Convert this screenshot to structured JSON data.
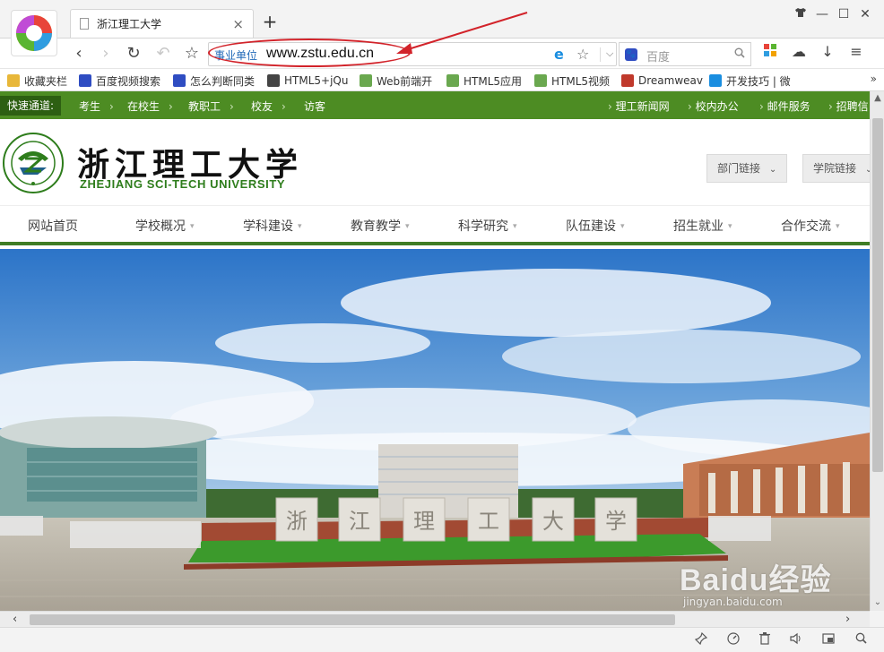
{
  "browser": {
    "tab": {
      "title": "浙江理工大学",
      "close": "×"
    },
    "new_tab": "+",
    "window_controls": {
      "minimize": "—",
      "maximize": "☐",
      "close": "✕",
      "skin": "👕"
    },
    "nav": {
      "back": "‹",
      "forward": "›",
      "reload": "↻",
      "undo": "↶",
      "favorite": "☆"
    },
    "address": {
      "badge": "事业单位",
      "url": "www.zstu.edu.cn"
    },
    "address_icons": {
      "ie": "e",
      "star": "☆",
      "dropdown": "⌵"
    },
    "search": {
      "placeholder": "百度",
      "engine_icon": "baidu-icon"
    },
    "tools": {
      "apps": "▦",
      "cloud": "☁",
      "download": "↓",
      "menu": "≡"
    },
    "bookmarks": [
      {
        "label": "收藏夹栏",
        "icon": "folder-icon",
        "color": "#e8b739"
      },
      {
        "label": "百度视频搜索",
        "icon": "baidu-icon",
        "color": "#2f4dc2"
      },
      {
        "label": "怎么判断同类",
        "icon": "baidu-icon",
        "color": "#2f4dc2"
      },
      {
        "label": "HTML5+jQu",
        "icon": "51-icon",
        "color": "#444444"
      },
      {
        "label": "Web前端开",
        "icon": "ji-icon",
        "color": "#6aa84f"
      },
      {
        "label": "HTML5应用",
        "icon": "ji-icon",
        "color": "#6aa84f"
      },
      {
        "label": "HTML5视频",
        "icon": "ji-icon",
        "color": "#6aa84f"
      },
      {
        "label": "Dreamweav",
        "icon": "dreamweaver-icon",
        "color": "#c0392b"
      },
      {
        "label": "开发技巧 | 微",
        "icon": "v-icon",
        "color": "#1a8ee0"
      }
    ],
    "bookmarks_more": "»"
  },
  "website": {
    "quick": {
      "label": "快速通道:",
      "items": [
        "考生",
        "在校生",
        "教职工",
        "校友",
        "访客"
      ],
      "right": [
        "理工新闻网",
        "校内办公",
        "邮件服务",
        "招聘信"
      ]
    },
    "header": {
      "name_cn": "浙江理工大学",
      "name_en": "ZHEJIANG SCI-TECH UNIVERSITY",
      "dept_links": "部门链接",
      "college_links": "学院链接"
    },
    "nav": [
      {
        "label": "网站首页",
        "has_menu": false
      },
      {
        "label": "学校概况",
        "has_menu": true
      },
      {
        "label": "学科建设",
        "has_menu": true
      },
      {
        "label": "教育教学",
        "has_menu": true
      },
      {
        "label": "科学研究",
        "has_menu": true
      },
      {
        "label": "队伍建设",
        "has_menu": true
      },
      {
        "label": "招生就业",
        "has_menu": true
      },
      {
        "label": "合作交流",
        "has_menu": true
      }
    ],
    "hero_chars": [
      "浙",
      "江",
      "理",
      "工",
      "大",
      "学"
    ]
  },
  "status_icons": [
    "pin-icon",
    "speed-icon",
    "trash-icon",
    "volume-icon",
    "window-icon",
    "zoom-icon"
  ],
  "watermark": {
    "main": "Baidu经验",
    "sub": "jingyan.baidu.com"
  },
  "colors": {
    "brand_green": "#4d8c23",
    "annotation_red": "#d2232a",
    "link_blue": "#1f68b8"
  }
}
